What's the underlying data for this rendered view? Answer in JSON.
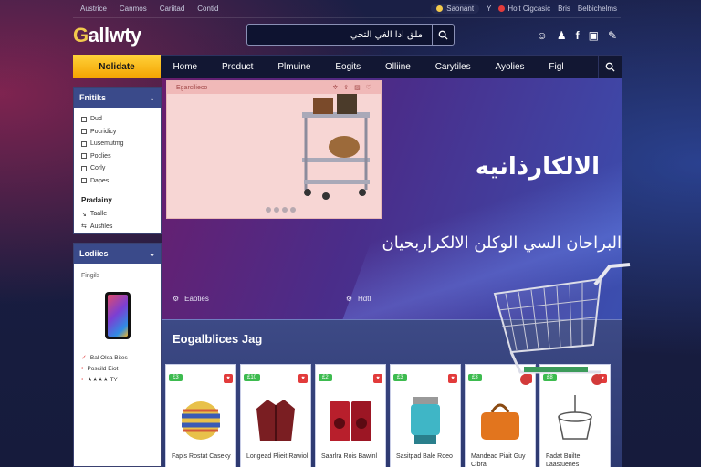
{
  "topbar": {
    "links": [
      "Austrice",
      "Canmos",
      "Cariitad",
      "Contid"
    ],
    "selector": "Saonant",
    "selector_caret": "Y",
    "right_links": [
      "Holt Cigcasic",
      "Bris",
      "Belbichelms"
    ]
  },
  "header": {
    "logo_a": "G",
    "logo_b": "allwty",
    "search_text": "ملق ادا الغي التحي"
  },
  "nav": {
    "category_label": "Nolidate",
    "items": [
      "Home",
      "Product",
      "Plmuine",
      "Eogits",
      "Olliine",
      "Carytiles",
      "Ayolies",
      "Figl"
    ]
  },
  "filters": {
    "title": "Fnitiks",
    "items": [
      "Dud",
      "Pocridicy",
      "Lusemutmg",
      "Poclies",
      "Corly",
      "Dapes"
    ],
    "subheading": "Pradainy",
    "sub_items": [
      "Taalle",
      "Ausfiles"
    ]
  },
  "lockers": {
    "title": "Lodiies",
    "caption": "Fingils",
    "items": [
      "Bal Olsa Bites",
      "Poscild Eiot",
      "★★★★ TY"
    ]
  },
  "hero": {
    "card_label": "Egarcilieco",
    "title": "الالكارذانيه",
    "subtitle": "البراحان السي الوكلن الالكراربحيان",
    "meta_left": "Eaoties",
    "meta_right": "Hdtl"
  },
  "section": {
    "title": "Eogalblices Jag",
    "products": [
      {
        "tag": "£3",
        "name": "Fapis Rostat Caseky"
      },
      {
        "tag": "£10",
        "name": "Longead Plieit Rawiol"
      },
      {
        "tag": "£2",
        "name": "Saarlra Rois Bawinl"
      },
      {
        "tag": "£3",
        "name": "Sasitpad Bale Roeo"
      },
      {
        "tag": "£3",
        "name": "Mandead Piait Guy Cibra"
      },
      {
        "tag": "£8",
        "name": "Fadat Builte Laastuenes"
      }
    ]
  },
  "colors": {
    "accent": "#f4a300",
    "nav_bg": "#121733",
    "panel_header": "#3a4a8a",
    "hero_start": "#6a1d6c",
    "hero_end": "#3b4fb0"
  }
}
